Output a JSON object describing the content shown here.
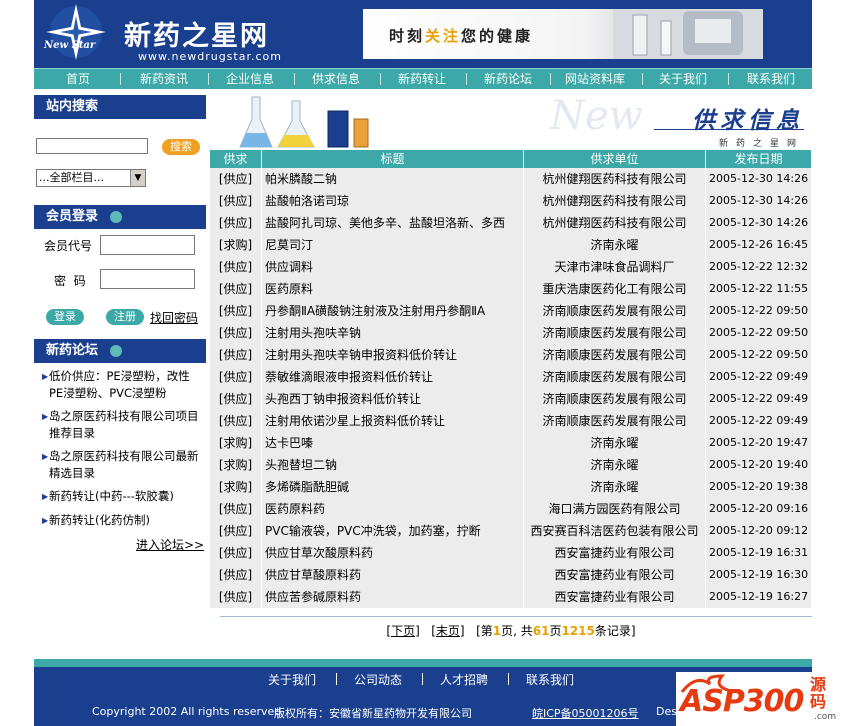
{
  "header": {
    "site_name": "新药之星网",
    "site_url": "www.newdrugstar.com",
    "logo_text": "New Star",
    "slogan_pre": "时刻",
    "slogan_hl": "关注",
    "slogan_post": "您的健康"
  },
  "nav": [
    {
      "label": "首页"
    },
    {
      "label": "新药资讯"
    },
    {
      "label": "企业信息"
    },
    {
      "label": "供求信息"
    },
    {
      "label": "新药转让"
    },
    {
      "label": "新药论坛"
    },
    {
      "label": "网站资料库"
    },
    {
      "label": "关于我们"
    },
    {
      "label": "联系我们"
    }
  ],
  "sidebar": {
    "search_title": "站内搜索",
    "search_button": "搜索",
    "category_select": "...全部栏目...",
    "login_title": "会员登录",
    "member_id_label": "会员代号",
    "password_label": "密  码",
    "login_button": "登录",
    "register_button": "注册",
    "forgot_password": "找回密码",
    "forum_title": "新药论坛",
    "forum_items": [
      "低价供应：PE浸塑粉，改性PE浸塑粉、PVC浸塑粉",
      "岛之原医药科技有限公司项目推荐目录",
      "岛之原医药科技有限公司最新精选目录",
      "新药转让(中药---软胶囊)",
      "新药转让(化药仿制)"
    ],
    "forum_more": "进入论坛>>"
  },
  "banner": {
    "title": "供求信息",
    "sub": "新药之星网",
    "watermark": "New"
  },
  "table": {
    "headers": {
      "type": "供求",
      "title": "标题",
      "unit": "供求单位",
      "date": "发布日期"
    },
    "rows": [
      {
        "type": "[供应]",
        "title": "帕米膦酸二钠",
        "unit": "杭州健翔医药科技有限公司",
        "date": "2005-12-30 14:26"
      },
      {
        "type": "[供应]",
        "title": "盐酸帕洛诺司琼",
        "unit": "杭州健翔医药科技有限公司",
        "date": "2005-12-30 14:26"
      },
      {
        "type": "[供应]",
        "title": "盐酸阿扎司琼、美他多辛、盐酸坦洛新、多西",
        "unit": "杭州健翔医药科技有限公司",
        "date": "2005-12-30 14:26"
      },
      {
        "type": "[求购]",
        "title": "尼莫司汀",
        "unit": "济南永曜",
        "date": "2005-12-26 16:45"
      },
      {
        "type": "[供应]",
        "title": "供应调料",
        "unit": "天津市津味食品调料厂",
        "date": "2005-12-22 12:32"
      },
      {
        "type": "[供应]",
        "title": "医药原料",
        "unit": "重庆浩康医药化工有限公司",
        "date": "2005-12-22 11:55"
      },
      {
        "type": "[供应]",
        "title": "丹参酮ⅡA磺酸钠注射液及注射用丹参酮ⅡA",
        "unit": "济南顺康医药发展有限公司",
        "date": "2005-12-22 09:50"
      },
      {
        "type": "[供应]",
        "title": "注射用头孢呋辛钠",
        "unit": "济南顺康医药发展有限公司",
        "date": "2005-12-22 09:50"
      },
      {
        "type": "[供应]",
        "title": "注射用头孢呋辛钠申报资料低价转让",
        "unit": "济南顺康医药发展有限公司",
        "date": "2005-12-22 09:50"
      },
      {
        "type": "[供应]",
        "title": "萘敏维滴眼液申报资料低价转让",
        "unit": "济南顺康医药发展有限公司",
        "date": "2005-12-22 09:49"
      },
      {
        "type": "[供应]",
        "title": "头孢西丁钠申报资料低价转让",
        "unit": "济南顺康医药发展有限公司",
        "date": "2005-12-22 09:49"
      },
      {
        "type": "[供应]",
        "title": "注射用依诺沙星上报资料低价转让",
        "unit": "济南顺康医药发展有限公司",
        "date": "2005-12-22 09:49"
      },
      {
        "type": "[求购]",
        "title": "达卡巴嗪",
        "unit": "济南永曜",
        "date": "2005-12-20 19:47"
      },
      {
        "type": "[求购]",
        "title": "头孢替坦二钠",
        "unit": "济南永曜",
        "date": "2005-12-20 19:40"
      },
      {
        "type": "[求购]",
        "title": "多烯磷脂酰胆碱",
        "unit": "济南永曜",
        "date": "2005-12-20 19:38"
      },
      {
        "type": "[供应]",
        "title": "医药原料药",
        "unit": "海口满方园医药有限公司",
        "date": "2005-12-20 09:16"
      },
      {
        "type": "[供应]",
        "title": "PVC输液袋，PVC冲洗袋，加药塞，拧断",
        "unit": "西安赛百科洁医药包装有限公司",
        "date": "2005-12-20 09:12"
      },
      {
        "type": "[供应]",
        "title": "供应甘草次酸原料药",
        "unit": "西安富捷药业有限公司",
        "date": "2005-12-19 16:31"
      },
      {
        "type": "[供应]",
        "title": "供应甘草酸原料药",
        "unit": "西安富捷药业有限公司",
        "date": "2005-12-19 16:30"
      },
      {
        "type": "[供应]",
        "title": "供应苦参碱原料药",
        "unit": "西安富捷药业有限公司",
        "date": "2005-12-19 16:27"
      }
    ]
  },
  "pager": {
    "next": "[下页]",
    "last": "[末页]",
    "t1": "[第",
    "page": "1",
    "t2": "页, 共",
    "total_pages": "61",
    "t3": "页",
    "total_records": "1215",
    "t4": "条记录]"
  },
  "footer": {
    "links": [
      "关于我们",
      "公司动态",
      "人才招聘",
      "联系我们"
    ],
    "copyright": "Copyright 2002 All rights reserved",
    "owner": "版权所有：安徽省新星药物开发有限公司",
    "icp": "皖ICP备05001206号",
    "des": "Des"
  },
  "watermark": {
    "asp": "ASP300",
    "code": "源码",
    "url": ".com"
  },
  "colors": {
    "brand_blue": "#1a3f8f",
    "teal": "#3ca8a8",
    "accent_orange": "#f0a020",
    "row_gray": "#ececec"
  }
}
